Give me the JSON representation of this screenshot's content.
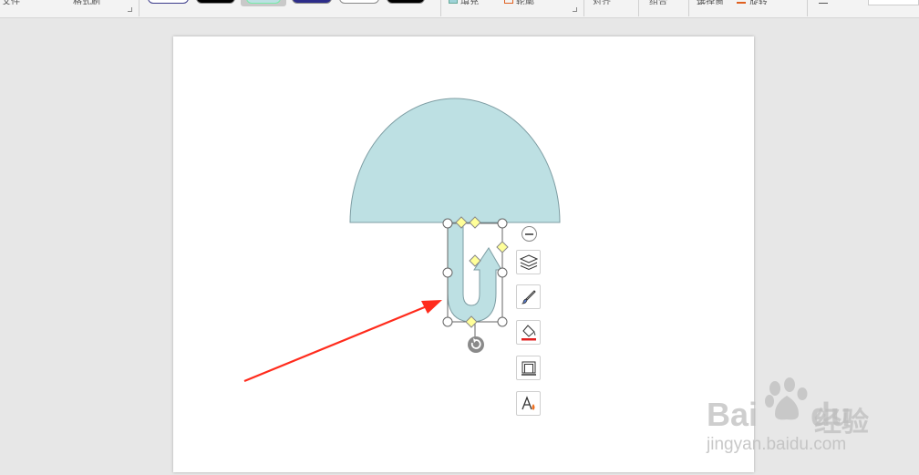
{
  "ribbon": {
    "partial_labels": [
      "文件",
      "格式刷",
      "填充",
      "轮廓",
      "效果",
      "对齐",
      "组合",
      "选择窗格",
      "旋转"
    ],
    "selected_style_index": 2
  },
  "slide": {
    "shapes": {
      "semicircle": {
        "fill": "#bde0e3",
        "stroke": "#7e9da3"
      },
      "u_turn_arrow": {
        "fill": "#bde0e3",
        "stroke": "#7e9da3",
        "selected": true
      }
    }
  },
  "float_toolbar": {
    "items": [
      {
        "name": "layers-icon",
        "label": "层"
      },
      {
        "name": "brush-icon",
        "label": "画笔"
      },
      {
        "name": "fill-icon",
        "label": "填充"
      },
      {
        "name": "outline-icon",
        "label": "轮廓"
      },
      {
        "name": "text-style-icon",
        "label": "A"
      }
    ]
  },
  "annotation_arrow": {
    "color": "#ff2b1c"
  },
  "watermark": {
    "logo_text": "Bai",
    "logo_text_2": "du",
    "cn_text": "经验",
    "url": "jingyan.baidu.com"
  },
  "colors": {
    "accent": "#ff2b1c",
    "shape_fill": "#bde0e3",
    "handle_yellow": "#ffff99"
  }
}
